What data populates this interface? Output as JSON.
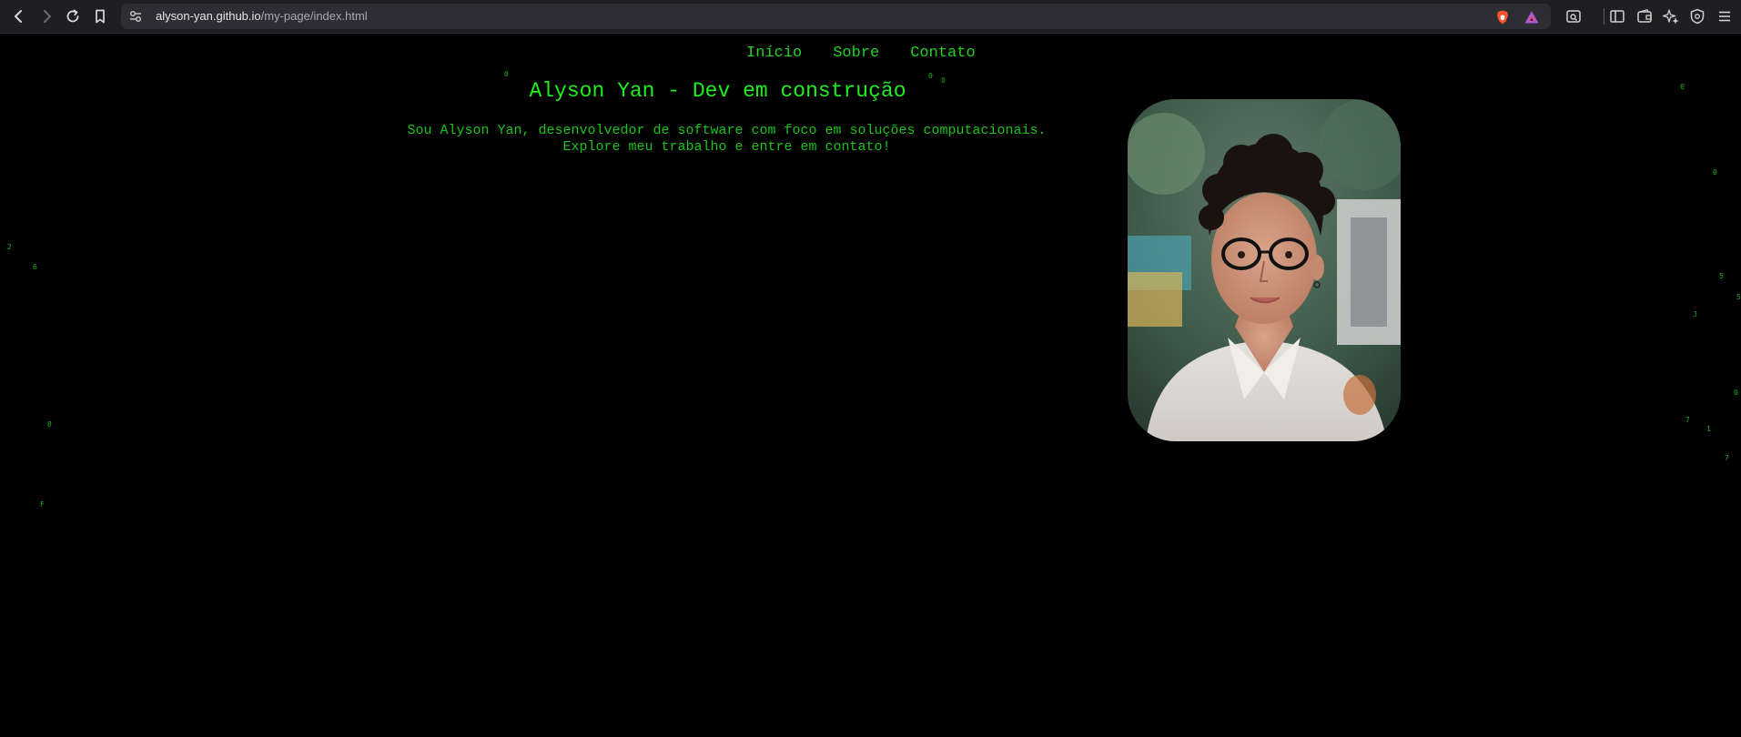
{
  "browser": {
    "url_host": "alyson-yan.github.io",
    "url_path": "/my-page/index.html",
    "icons": [
      "back-icon",
      "forward-icon",
      "reload-icon",
      "bookmark-icon",
      "site-settings-icon",
      "brave-shield-icon",
      "brave-rewards-icon",
      "screenshot-icon",
      "sidebar-icon",
      "wallet-icon",
      "leo-ai-icon",
      "vpn-icon",
      "menu-icon"
    ]
  },
  "nav": {
    "items": [
      {
        "label": "Início"
      },
      {
        "label": "Sobre"
      },
      {
        "label": "Contato"
      }
    ]
  },
  "hero": {
    "title": "Alyson Yan - Dev em construção",
    "intro_line1": "Sou Alyson Yan, desenvolvedor de software com foco em soluções computacionais.",
    "intro_line2": "Explore meu trabalho e entre em contato!"
  },
  "matrix_rain": {
    "color": "#19b019",
    "chars": [
      "0",
      "0",
      "0",
      "6",
      "0",
      "2",
      "6",
      "5",
      "8",
      "F",
      "J",
      "0",
      "7",
      "1",
      "7",
      "5"
    ]
  },
  "colors": {
    "accent": "#1df01d",
    "text": "#17c417",
    "background": "#000000",
    "chrome": "#1f1f23"
  }
}
